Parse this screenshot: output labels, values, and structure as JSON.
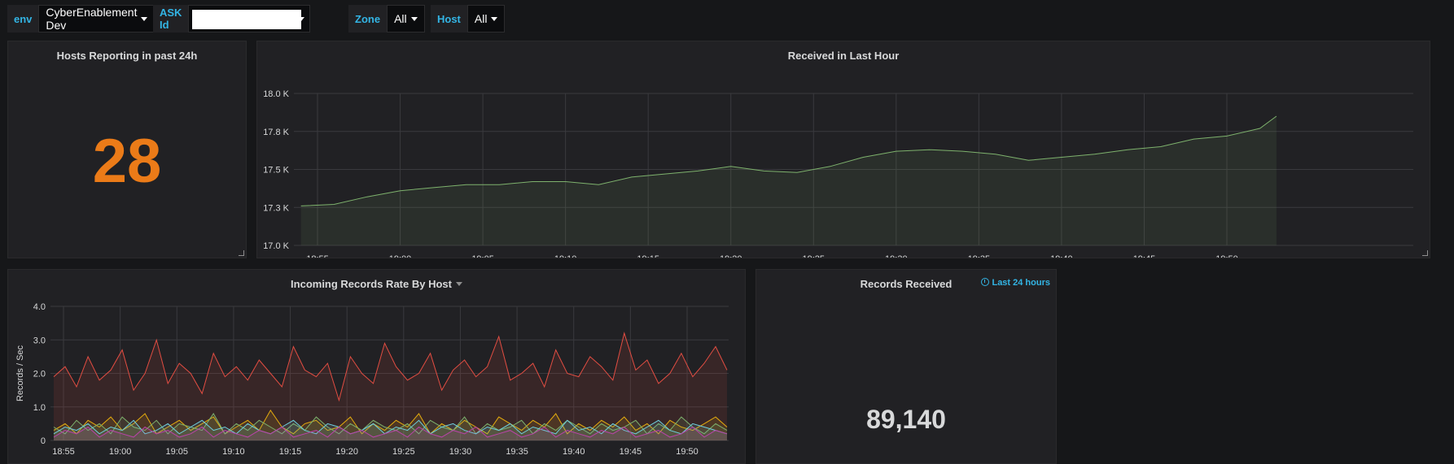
{
  "variables": {
    "env": {
      "label": "env",
      "value": "CyberEnablement Dev"
    },
    "ask_id": {
      "label": "ASK Id",
      "value": ""
    },
    "zone": {
      "label": "Zone",
      "value": "All"
    },
    "host": {
      "label": "Host",
      "value": "All"
    }
  },
  "panels": {
    "hosts_reporting": {
      "title": "Hosts Reporting in past 24h",
      "value": "28",
      "color": "#eb7b18"
    },
    "received_last_hour": {
      "title": "Received in Last Hour"
    },
    "incoming_rate": {
      "title": "Incoming Records Rate By Host"
    },
    "records_received": {
      "title": "Records Received",
      "time_info": "Last 24 hours",
      "value": "89,140"
    }
  },
  "chart_data": [
    {
      "type": "area",
      "title": "Received in Last Hour",
      "ylim": [
        17.0,
        18.0
      ],
      "y_ticks": [
        "18.0 K",
        "17.8 K",
        "17.5 K",
        "17.3 K",
        "17.0 K"
      ],
      "x_ticks": [
        "18:55",
        "19:00",
        "19:05",
        "19:10",
        "19:15",
        "19:20",
        "19:25",
        "19:30",
        "19:35",
        "19:40",
        "19:45",
        "19:50"
      ],
      "grid": true,
      "line_color": "#7eb26d",
      "series": [
        {
          "x": [
            "18:54",
            "18:56",
            "18:58",
            "19:00",
            "19:02",
            "19:04",
            "19:06",
            "19:08",
            "19:10",
            "19:12",
            "19:14",
            "19:16",
            "19:18",
            "19:20",
            "19:22",
            "19:24",
            "19:26",
            "19:28",
            "19:30",
            "19:32",
            "19:34",
            "19:36",
            "19:38",
            "19:40",
            "19:42",
            "19:44",
            "19:46",
            "19:48",
            "19:50",
            "19:52",
            "19:53"
          ],
          "values": [
            17.26,
            17.27,
            17.32,
            17.36,
            17.38,
            17.4,
            17.4,
            17.42,
            17.42,
            17.4,
            17.45,
            17.47,
            17.49,
            17.52,
            17.49,
            17.48,
            17.52,
            17.58,
            17.62,
            17.63,
            17.62,
            17.6,
            17.56,
            17.58,
            17.6,
            17.63,
            17.65,
            17.7,
            17.72,
            17.77,
            17.85
          ]
        }
      ]
    },
    {
      "type": "line",
      "title": "Incoming Records Rate By Host",
      "ylabel": "Records / Sec",
      "ylim": [
        0,
        4.0
      ],
      "y_ticks": [
        "4.0",
        "3.0",
        "2.0",
        "1.0",
        "0"
      ],
      "x_ticks": [
        "18:55",
        "19:00",
        "19:05",
        "19:10",
        "19:15",
        "19:20",
        "19:25",
        "19:30",
        "19:35",
        "19:40",
        "19:45",
        "19:50"
      ],
      "grid": true,
      "series": [
        {
          "color": "#e24d42",
          "values": [
            1.9,
            2.2,
            1.6,
            2.5,
            1.8,
            2.1,
            2.7,
            1.5,
            2.0,
            3.0,
            1.7,
            2.3,
            2.0,
            1.4,
            2.6,
            1.9,
            2.2,
            1.8,
            2.4,
            2.0,
            1.6,
            2.8,
            2.1,
            1.9,
            2.3,
            1.2,
            2.5,
            2.0,
            1.7,
            2.9,
            2.2,
            1.8,
            2.0,
            2.6,
            1.5,
            2.1,
            2.4,
            1.9,
            2.2,
            3.1,
            1.8,
            2.0,
            2.3,
            1.6,
            2.7,
            2.0,
            1.9,
            2.5,
            2.2,
            1.8,
            3.2,
            2.1,
            2.4,
            1.7,
            2.0,
            2.6,
            1.9,
            2.3,
            2.8,
            2.1
          ]
        },
        {
          "color": "#e5ac0e",
          "values": [
            0.3,
            0.5,
            0.2,
            0.6,
            0.4,
            0.7,
            0.3,
            0.5,
            0.8,
            0.2,
            0.4,
            0.6,
            0.3,
            0.5,
            0.7,
            0.2,
            0.4,
            0.6,
            0.3,
            0.9,
            0.4,
            0.2,
            0.5,
            0.6,
            0.3,
            0.4,
            0.7,
            0.2,
            0.5,
            0.3,
            0.6,
            0.4,
            0.8,
            0.2,
            0.5,
            0.3,
            0.6,
            0.4,
            0.2,
            0.7,
            0.5,
            0.3,
            0.6,
            0.4,
            0.8,
            0.2,
            0.5,
            0.3,
            0.6,
            0.4,
            0.7,
            0.3,
            0.5,
            0.2,
            0.6,
            0.4,
            0.3,
            0.5,
            0.7,
            0.4
          ]
        },
        {
          "color": "#7eb26d",
          "values": [
            0.4,
            0.2,
            0.6,
            0.3,
            0.5,
            0.2,
            0.7,
            0.4,
            0.3,
            0.6,
            0.2,
            0.5,
            0.4,
            0.3,
            0.8,
            0.2,
            0.5,
            0.3,
            0.6,
            0.4,
            0.2,
            0.5,
            0.3,
            0.7,
            0.4,
            0.2,
            0.5,
            0.3,
            0.6,
            0.4,
            0.3,
            0.5,
            0.2,
            0.6,
            0.4,
            0.3,
            0.7,
            0.2,
            0.5,
            0.3,
            0.4,
            0.6,
            0.2,
            0.5,
            0.3,
            0.6,
            0.4,
            0.2,
            0.5,
            0.3,
            0.4,
            0.6,
            0.2,
            0.5,
            0.3,
            0.7,
            0.4,
            0.2,
            0.5,
            0.3
          ]
        },
        {
          "color": "#6ed0e0",
          "values": [
            0.2,
            0.4,
            0.3,
            0.5,
            0.2,
            0.4,
            0.3,
            0.6,
            0.2,
            0.3,
            0.5,
            0.2,
            0.4,
            0.6,
            0.3,
            0.4,
            0.2,
            0.5,
            0.3,
            0.2,
            0.4,
            0.6,
            0.3,
            0.2,
            0.5,
            0.4,
            0.2,
            0.3,
            0.5,
            0.2,
            0.4,
            0.3,
            0.6,
            0.2,
            0.4,
            0.5,
            0.3,
            0.2,
            0.4,
            0.3,
            0.5,
            0.2,
            0.4,
            0.3,
            0.2,
            0.6,
            0.3,
            0.4,
            0.2,
            0.5,
            0.3,
            0.2,
            0.4,
            0.6,
            0.3,
            0.2,
            0.5,
            0.4,
            0.3,
            0.2
          ]
        },
        {
          "color": "#ba43a9",
          "values": [
            0.1,
            0.3,
            0.2,
            0.4,
            0.1,
            0.3,
            0.2,
            0.1,
            0.4,
            0.2,
            0.3,
            0.1,
            0.2,
            0.4,
            0.1,
            0.3,
            0.2,
            0.1,
            0.3,
            0.2,
            0.4,
            0.1,
            0.2,
            0.3,
            0.1,
            0.4,
            0.2,
            0.3,
            0.1,
            0.2,
            0.3,
            0.1,
            0.4,
            0.2,
            0.1,
            0.3,
            0.2,
            0.4,
            0.1,
            0.2,
            0.3,
            0.1,
            0.2,
            0.4,
            0.1,
            0.3,
            0.2,
            0.1,
            0.3,
            0.2,
            0.4,
            0.1,
            0.2,
            0.3,
            0.1,
            0.2,
            0.4,
            0.1,
            0.3,
            0.2
          ]
        }
      ]
    }
  ]
}
